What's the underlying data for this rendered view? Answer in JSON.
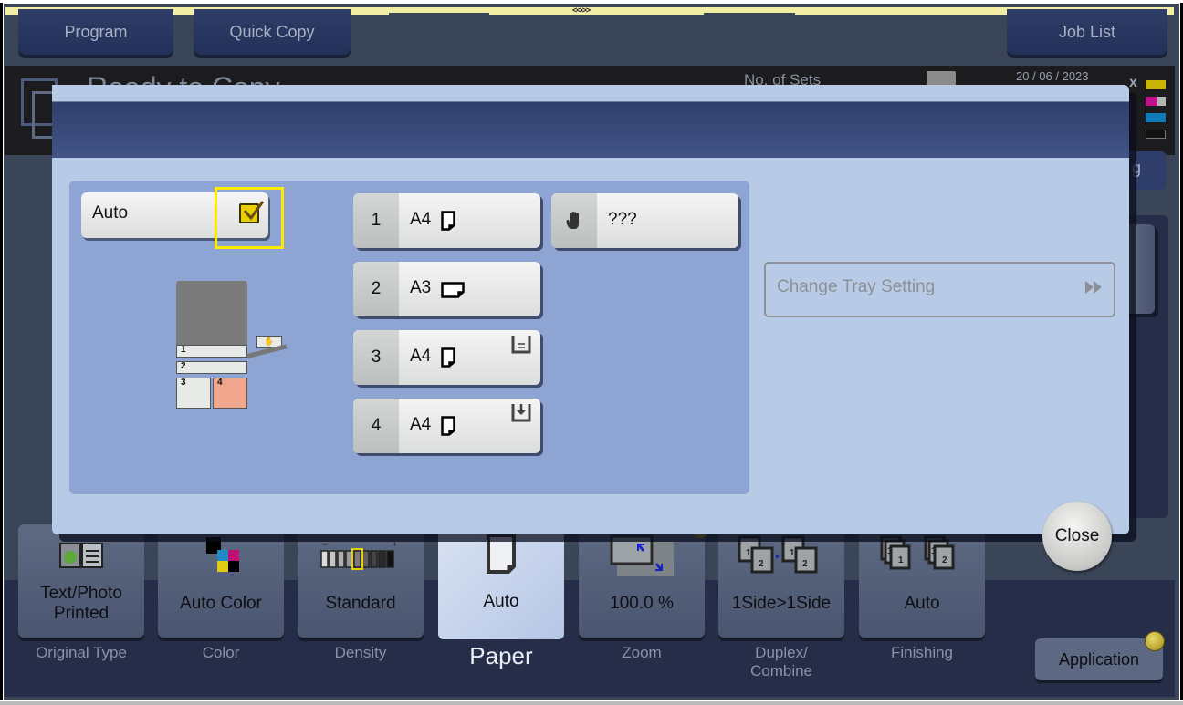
{
  "header": {
    "drag_handle": "<<•>>",
    "buttons": [
      {
        "id": "program",
        "label": "Program"
      },
      {
        "id": "quick-copy",
        "label": "Quick Copy"
      },
      {
        "id": "job-list",
        "label": "Job List"
      }
    ]
  },
  "status": {
    "message": "Ready to Copy",
    "sets_label": "No. of Sets",
    "date": "20 / 06 / 2023",
    "toner_colors": [
      "#c9b500",
      "#c0108a",
      "#1079b8",
      "#111111"
    ],
    "partial_button_text": "g"
  },
  "dialog": {
    "title": "",
    "auto": {
      "label": "Auto",
      "checked": true
    },
    "diagram": {
      "trays": [
        "1",
        "2",
        "3",
        "4"
      ],
      "highlighted_tray": "4",
      "bypass_icon": "hand-icon"
    },
    "trays": [
      {
        "number": "1",
        "size": "A4",
        "orientation": "portrait",
        "badge": null
      },
      {
        "number": "2",
        "size": "A3",
        "orientation": "landscape",
        "badge": null
      },
      {
        "number": "3",
        "size": "A4",
        "orientation": "portrait",
        "badge": "paper-stack-icon"
      },
      {
        "number": "4",
        "size": "A4",
        "orientation": "portrait",
        "badge": "tray-load-icon"
      }
    ],
    "bypass": {
      "icon": "hand-icon",
      "size": "???"
    },
    "change_tray_setting": "Change Tray Setting",
    "close_label": "Close"
  },
  "function_bar": {
    "tabs": [
      {
        "id": "original-type",
        "value": "Text/Photo\nPrinted",
        "value_lines": [
          "Text/Photo",
          "Printed"
        ],
        "label": "Original Type",
        "active": false
      },
      {
        "id": "color",
        "value": "Auto Color",
        "label": "Color",
        "active": false
      },
      {
        "id": "density",
        "value": "Standard",
        "label": "Density",
        "active": false
      },
      {
        "id": "paper",
        "value": "Auto",
        "label": "Paper",
        "active": true
      },
      {
        "id": "zoom",
        "value": "100.0 %",
        "label": "Zoom",
        "active": false
      },
      {
        "id": "duplex",
        "value": "1Side>1Side",
        "label_lines": [
          "Duplex/",
          "Combine"
        ],
        "label": "Duplex/ Combine",
        "active": false
      },
      {
        "id": "finishing",
        "value": "Auto",
        "label": "Finishing",
        "active": false
      }
    ],
    "application_label": "Application"
  },
  "colors": {
    "highlight": "#ffea00",
    "dialog_bg": "#b8cbe6",
    "tray_area": "#8ea4d2",
    "tray4_highlight": "#f1a68e"
  }
}
